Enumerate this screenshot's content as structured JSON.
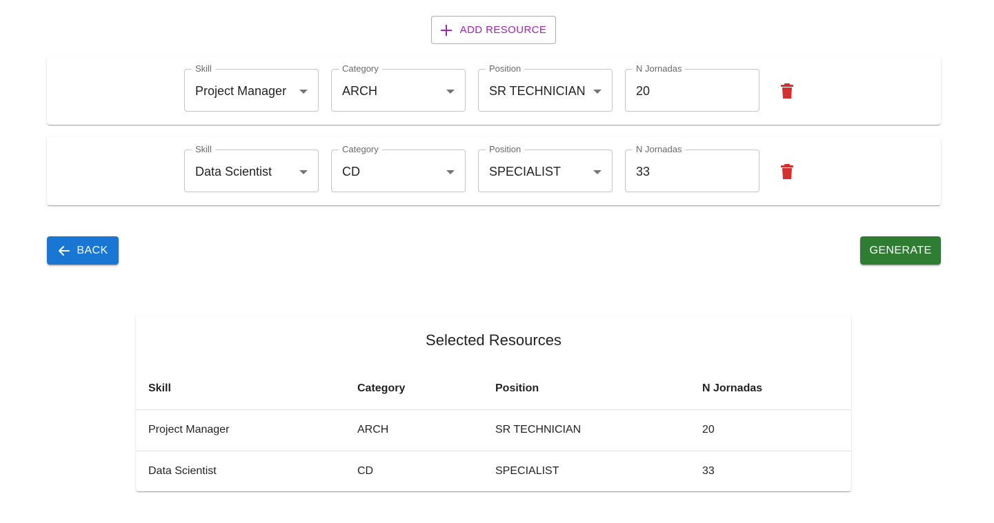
{
  "toolbar": {
    "add_label": "ADD RESOURCE"
  },
  "field_labels": {
    "skill": "Skill",
    "category": "Category",
    "position": "Position",
    "jornadas": "N Jornadas"
  },
  "rows": [
    {
      "skill": "Project Manager",
      "category": "ARCH",
      "position": "SR TECHNICIAN",
      "jornadas": "20"
    },
    {
      "skill": "Data Scientist",
      "category": "CD",
      "position": "SPECIALIST",
      "jornadas": "33"
    }
  ],
  "actions": {
    "back_label": "BACK",
    "generate_label": "GENERATE"
  },
  "summary": {
    "title": "Selected Resources",
    "headers": [
      "Skill",
      "Category",
      "Position",
      "N Jornadas"
    ],
    "rows": [
      [
        "Project Manager",
        "ARCH",
        "SR TECHNICIAN",
        "20"
      ],
      [
        "Data Scientist",
        "CD",
        "SPECIALIST",
        "33"
      ]
    ]
  },
  "colors": {
    "primary": "#1976d2",
    "success": "#2e7d32",
    "secondary": "#9c27b0",
    "danger": "#d32f2f"
  },
  "icons": {
    "add": "plus-icon",
    "delete": "trash-icon",
    "back": "arrow-left-icon",
    "dropdown": "caret-down-icon"
  }
}
